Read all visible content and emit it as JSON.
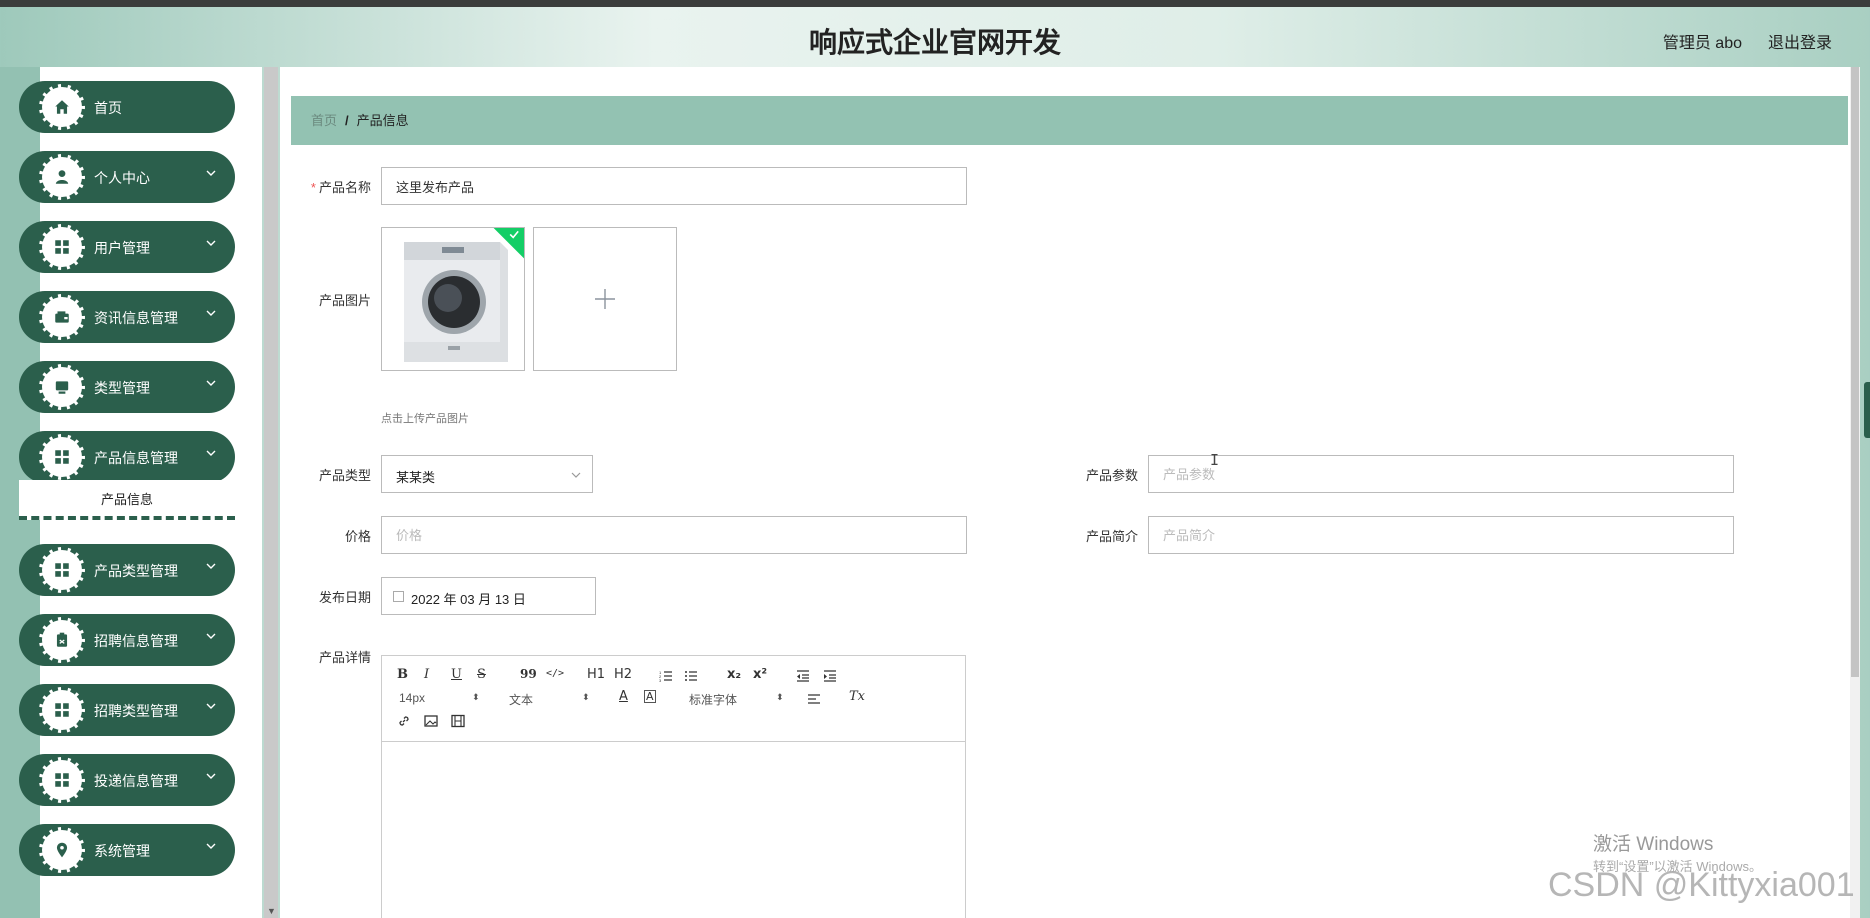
{
  "header": {
    "title": "响应式企业官网开发",
    "admin": "管理员 abo",
    "logout": "退出登录"
  },
  "sidebar": {
    "items": [
      {
        "label": "首页",
        "icon": "home-icon"
      },
      {
        "label": "个人中心",
        "icon": "user-icon"
      },
      {
        "label": "用户管理",
        "icon": "grid-icon"
      },
      {
        "label": "资讯信息管理",
        "icon": "wallet-icon"
      },
      {
        "label": "类型管理",
        "icon": "monitor-icon"
      },
      {
        "label": "产品信息管理",
        "icon": "grid-icon"
      },
      {
        "label": "产品类型管理",
        "icon": "grid-icon"
      },
      {
        "label": "招聘信息管理",
        "icon": "clipboard-icon"
      },
      {
        "label": "招聘类型管理",
        "icon": "grid-icon"
      },
      {
        "label": "投递信息管理",
        "icon": "grid-icon"
      },
      {
        "label": "系统管理",
        "icon": "location-icon"
      }
    ],
    "submenu": "产品信息"
  },
  "breadcrumb": {
    "home": "首页",
    "separator": "/",
    "current": "产品信息"
  },
  "form": {
    "name_label": "产品名称",
    "name_value": "这里发布产品",
    "image_label": "产品图片",
    "upload_plus": "+",
    "upload_hint": "点击上传产品图片",
    "type_label": "产品类型",
    "type_value": "某某类",
    "params_label": "产品参数",
    "params_placeholder": "产品参数",
    "price_label": "价格",
    "price_placeholder": "价格",
    "intro_label": "产品简介",
    "intro_placeholder": "产品简介",
    "date_label": "发布日期",
    "date_value": "2022 年 03 月 13 日",
    "detail_label": "产品详情",
    "required_mark": "*"
  },
  "editor": {
    "bold": "B",
    "italic": "I",
    "underline": "U",
    "strike": "S",
    "quote": "99",
    "code": "</>",
    "h1": "H1",
    "h2": "H2",
    "sub": "x₂",
    "sup": "x²",
    "size": "14px",
    "block": "文本",
    "font": "标准字体",
    "clear": "Tx",
    "color": "A"
  },
  "watermark": {
    "activate": "激活 Windows",
    "activate_hint": "转到“设置”以激活 Windows。",
    "csdn": "CSDN @Kittyxia001"
  },
  "colors": {
    "accent": "#2b5f4c",
    "breadcrumb_bg": "#93c2b2",
    "success": "#13ce66"
  }
}
